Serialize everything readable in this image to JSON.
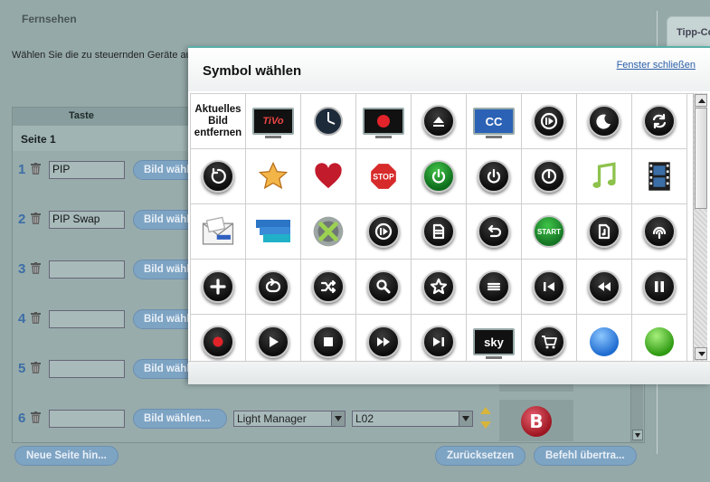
{
  "page": {
    "section_title": "Fernsehen",
    "instructions": "Wählen Sie die zu steuernden Geräte aus",
    "tip_label": "Tipp-Co"
  },
  "table": {
    "col_taste": "Taste",
    "page_label": "Seite 1",
    "button_label": "Bild wählen...",
    "rows": [
      {
        "num": "1",
        "name": "PIP"
      },
      {
        "num": "2",
        "name": "PIP Swap"
      },
      {
        "num": "3",
        "name": ""
      },
      {
        "num": "4",
        "name": ""
      },
      {
        "num": "5",
        "name": ""
      },
      {
        "num": "6",
        "name": "",
        "device": "Light Manager",
        "code": "L02",
        "preview_letter": "B"
      }
    ]
  },
  "footer": {
    "new_page": "Neue Seite hin...",
    "reset": "Zurücksetzen",
    "transfer": "Befehl übertra..."
  },
  "modal": {
    "title": "Symbol wählen",
    "close": "Fenster schließen",
    "remove_text": "Aktuelles Bild entfernen",
    "cells": [
      "remove",
      "tivo-tv-icon",
      "clock-icon",
      "tv-record-icon",
      "eject-icon",
      "cc-tv-icon",
      "play-pause-icon",
      "sleep-moon-icon",
      "swap-icon",
      "replay-icon",
      "star-icon",
      "heart-icon",
      "stop-sign-icon",
      "power-green-icon",
      "power-icon",
      "power-ring-icon",
      "music-note-icon",
      "film-icon",
      "email-icon",
      "my-media-icon",
      "xbox-icon",
      "play-pause-icon-2",
      "document-icon",
      "back-icon",
      "start-icon",
      "music-file-icon",
      "signal-icon",
      "plus-icon",
      "loop-icon",
      "shuffle-icon",
      "search-icon",
      "favorite-star-icon",
      "guide-icon",
      "skip-back-icon",
      "rewind-icon",
      "pause-icon",
      "record-icon",
      "play-icon",
      "stop-icon",
      "fast-forward-icon",
      "skip-forward-icon",
      "sky-tv-icon",
      "cart-icon",
      "blue-button-icon",
      "green-button-icon"
    ],
    "labels": {
      "tivo": "TiVo",
      "cc": "CC",
      "start": "START",
      "stop": "STOP",
      "sky": "sky"
    },
    "colors": {
      "accent": "#58b0a8",
      "link": "#2a5ea8"
    }
  }
}
